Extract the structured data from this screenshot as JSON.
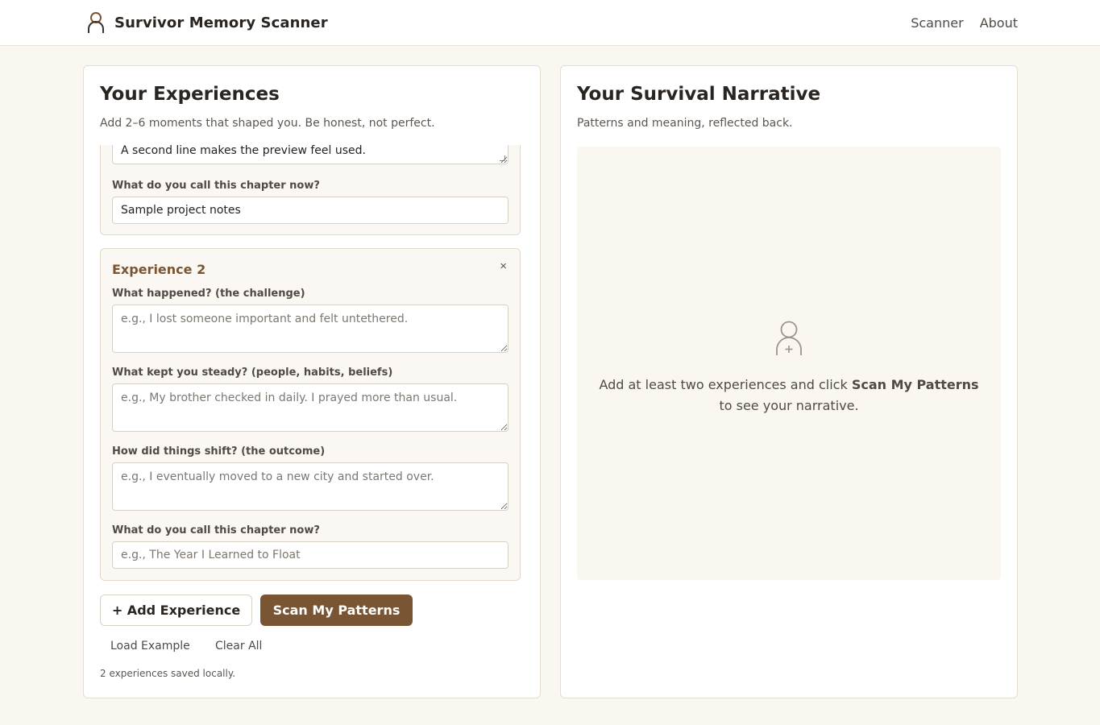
{
  "header": {
    "app_title": "Survivor Memory Scanner",
    "logo_icon": "person-outline-icon",
    "nav": [
      {
        "label": "Scanner"
      },
      {
        "label": "About"
      }
    ]
  },
  "experiences_panel": {
    "title": "Your Experiences",
    "subtitle": "Add 2–6 moments that shaped you. Be honest, not perfect.",
    "experience_1": {
      "partial_text": "A second line makes the preview feel used.",
      "chapter_label": "What do you call this chapter now?",
      "chapter_value": "Sample project notes"
    },
    "experience_2": {
      "title": "Experience 2",
      "close_symbol": "×",
      "challenge_label": "What happened? (the challenge)",
      "challenge_placeholder": "e.g., I lost someone important and felt untethered.",
      "steady_label": "What kept you steady? (people, habits, beliefs)",
      "steady_placeholder": "e.g., My brother checked in daily. I prayed more than usual.",
      "outcome_label": "How did things shift? (the outcome)",
      "outcome_placeholder": "e.g., I eventually moved to a new city and started over.",
      "chapter_label": "What do you call this chapter now?",
      "chapter_placeholder": "e.g., The Year I Learned to Float"
    },
    "add_button_label": "+ Add Experience",
    "scan_button_label": "Scan My Patterns",
    "load_example_label": "Load Example",
    "clear_all_label": "Clear All",
    "status": "2 experiences saved locally."
  },
  "narrative_panel": {
    "title": "Your Survival Narrative",
    "subtitle": "Patterns and meaning, reflected back.",
    "empty_icon": "person-add-icon",
    "empty_text_before": "Add at least two experiences and click ",
    "empty_text_emphasis": "Scan My Patterns",
    "empty_text_after": " to see your narrative."
  },
  "colors": {
    "accent": "#7a5533",
    "background": "#faf7f1",
    "card_border": "#e3d9c9"
  }
}
